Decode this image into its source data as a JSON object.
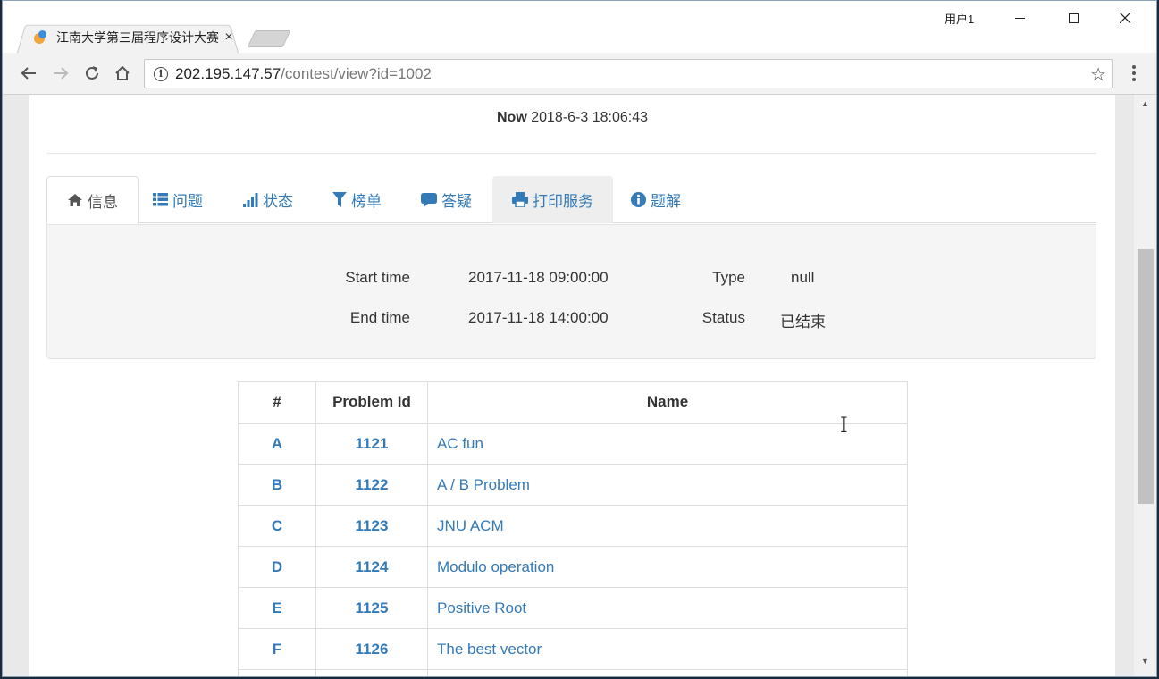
{
  "browser": {
    "tab_title": "江南大学第三届程序设计大赛",
    "tab_close": "×",
    "user_label": "用户1",
    "url_host": "202.195.147.57",
    "url_path": "/contest/view?id=1002",
    "icons": {
      "back": "back-arrow-icon",
      "forward": "forward-arrow-icon",
      "reload": "reload-icon",
      "home": "home-icon",
      "info": "info-icon",
      "star": "star-icon",
      "menu": "kebab-menu-icon"
    }
  },
  "header": {
    "now_label": "Now",
    "now_value": "2018-6-3 18:06:43"
  },
  "tabs": [
    {
      "label": "信息",
      "icon": "home-icon"
    },
    {
      "label": "问题",
      "icon": "list-icon"
    },
    {
      "label": "状态",
      "icon": "signal-bars-icon"
    },
    {
      "label": "榜单",
      "icon": "filter-icon"
    },
    {
      "label": "答疑",
      "icon": "comment-icon"
    },
    {
      "label": "打印服务",
      "icon": "print-icon"
    },
    {
      "label": "题解",
      "icon": "info-circle-icon"
    }
  ],
  "info": {
    "start_label": "Start time",
    "start_value": "2017-11-18 09:00:00",
    "end_label": "End time",
    "end_value": "2017-11-18 14:00:00",
    "type_label": "Type",
    "type_value": "null",
    "status_label": "Status",
    "status_value": "已结束"
  },
  "problems": {
    "headers": [
      "#",
      "Problem Id",
      "Name"
    ],
    "rows": [
      {
        "idx": "A",
        "id": "1121",
        "name": "AC fun"
      },
      {
        "idx": "B",
        "id": "1122",
        "name": "A / B Problem"
      },
      {
        "idx": "C",
        "id": "1123",
        "name": "JNU ACM"
      },
      {
        "idx": "D",
        "id": "1124",
        "name": "Modulo operation"
      },
      {
        "idx": "E",
        "id": "1125",
        "name": "Positive Root"
      },
      {
        "idx": "F",
        "id": "1126",
        "name": "The best vector"
      }
    ]
  },
  "colors": {
    "link": "#337ab7",
    "panel_bg": "#f5f5f5",
    "text": "#333333"
  }
}
